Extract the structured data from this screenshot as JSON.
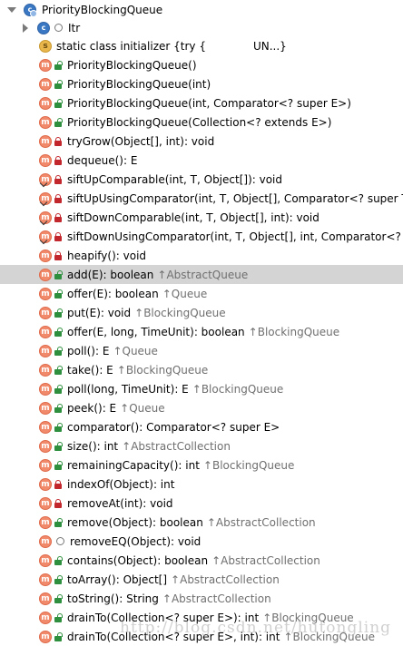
{
  "tree": {
    "root": {
      "label": "PriorityBlockingQueue",
      "icon": "class-icon"
    },
    "itr": {
      "label": "Itr",
      "icon": "class-icon"
    },
    "initializer": {
      "label": "static class initializer {try {",
      "tail": "UN...}",
      "icon": "static-initializer-icon"
    },
    "members": [
      {
        "label": "PriorityBlockingQueue()",
        "access": "public",
        "super": ""
      },
      {
        "label": "PriorityBlockingQueue(int)",
        "access": "public",
        "super": ""
      },
      {
        "label": "PriorityBlockingQueue(int, Comparator<? super E>)",
        "access": "public",
        "super": ""
      },
      {
        "label": "PriorityBlockingQueue(Collection<? extends E>)",
        "access": "public",
        "super": ""
      },
      {
        "label": "tryGrow(Object[], int): void",
        "access": "private",
        "super": ""
      },
      {
        "label": "dequeue(): E",
        "access": "private",
        "super": ""
      },
      {
        "label": "siftUpComparable(int, T, Object[]): void",
        "access": "private",
        "super": "",
        "static": true
      },
      {
        "label": "siftUpUsingComparator(int, T, Object[], Comparator<? super T>",
        "access": "private",
        "super": "",
        "static": true
      },
      {
        "label": "siftDownComparable(int, T, Object[], int): void",
        "access": "private",
        "super": "",
        "static": true
      },
      {
        "label": "siftDownUsingComparator(int, T, Object[], int, Comparator<? su",
        "access": "private",
        "super": "",
        "static": true
      },
      {
        "label": "heapify(): void",
        "access": "private",
        "super": ""
      },
      {
        "label": "add(E): boolean",
        "access": "public",
        "super": "AbstractQueue",
        "selected": true
      },
      {
        "label": "offer(E): boolean",
        "access": "public",
        "super": "Queue"
      },
      {
        "label": "put(E): void",
        "access": "public",
        "super": "BlockingQueue"
      },
      {
        "label": "offer(E, long, TimeUnit): boolean",
        "access": "public",
        "super": "BlockingQueue"
      },
      {
        "label": "poll(): E",
        "access": "public",
        "super": "Queue"
      },
      {
        "label": "take(): E",
        "access": "public",
        "super": "BlockingQueue"
      },
      {
        "label": "poll(long, TimeUnit): E",
        "access": "public",
        "super": "BlockingQueue"
      },
      {
        "label": "peek(): E",
        "access": "public",
        "super": "Queue"
      },
      {
        "label": "comparator(): Comparator<? super E>",
        "access": "public",
        "super": ""
      },
      {
        "label": "size(): int",
        "access": "public",
        "super": "AbstractCollection"
      },
      {
        "label": "remainingCapacity(): int",
        "access": "public",
        "super": "BlockingQueue"
      },
      {
        "label": "indexOf(Object): int",
        "access": "private",
        "super": ""
      },
      {
        "label": "removeAt(int): void",
        "access": "private",
        "super": ""
      },
      {
        "label": "remove(Object): boolean",
        "access": "public",
        "super": "AbstractCollection"
      },
      {
        "label": "removeEQ(Object): void",
        "access": "package",
        "super": ""
      },
      {
        "label": "contains(Object): boolean",
        "access": "public",
        "super": "AbstractCollection"
      },
      {
        "label": "toArray(): Object[]",
        "access": "public",
        "super": "AbstractCollection"
      },
      {
        "label": "toString(): String",
        "access": "public",
        "super": "AbstractCollection"
      },
      {
        "label": "drainTo(Collection<? super E>): int",
        "access": "public",
        "super": "BlockingQueue"
      },
      {
        "label": "drainTo(Collection<? super E>, int): int",
        "access": "public",
        "super": "BlockingQueue"
      }
    ]
  },
  "watermark": {
    "text": "http://blog.csdn.net/hutongling"
  },
  "colors": {
    "selected_row": "#d4d4d4",
    "method_icon": "#f08a6b",
    "public_lock": "#2e8f3e",
    "private_lock": "#c1272d",
    "class_icon": "#3a78c4"
  },
  "glyphs": {
    "method": "m",
    "class": "c",
    "initializer": "s",
    "super_arrow": "↑"
  }
}
